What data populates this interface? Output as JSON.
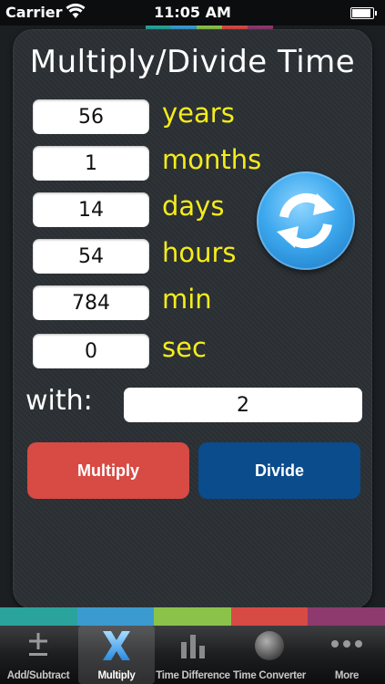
{
  "status_bar": {
    "carrier": "Carrier",
    "time": "11:05 AM"
  },
  "title": "Multiply/Divide Time",
  "fields": [
    {
      "value": "56",
      "unit": "years"
    },
    {
      "value": "1",
      "unit": "months"
    },
    {
      "value": "14",
      "unit": "days"
    },
    {
      "value": "54",
      "unit": "hours"
    },
    {
      "value": "784",
      "unit": "min"
    },
    {
      "value": "0",
      "unit": "sec"
    }
  ],
  "with": {
    "label": "with:",
    "value": "2"
  },
  "actions": {
    "multiply": "Multiply",
    "divide": "Divide"
  },
  "colors": {
    "accent_yellow": "#f5ec1c",
    "multiply_red": "#d84a44",
    "divide_blue": "#0b4c8c",
    "ribbon": [
      "#2aa39c",
      "#3b9bd1",
      "#8bc34a",
      "#d84a44",
      "#8e3a6e"
    ]
  },
  "tabs": [
    {
      "label": "Add/Subtract",
      "icon": "plus-minus-icon"
    },
    {
      "label": "Multiply",
      "icon": "x-icon",
      "active": true
    },
    {
      "label": "Time Difference",
      "icon": "bar-chart-icon"
    },
    {
      "label": "Time Converter",
      "icon": "sphere-icon"
    },
    {
      "label": "More",
      "icon": "more-icon"
    }
  ]
}
